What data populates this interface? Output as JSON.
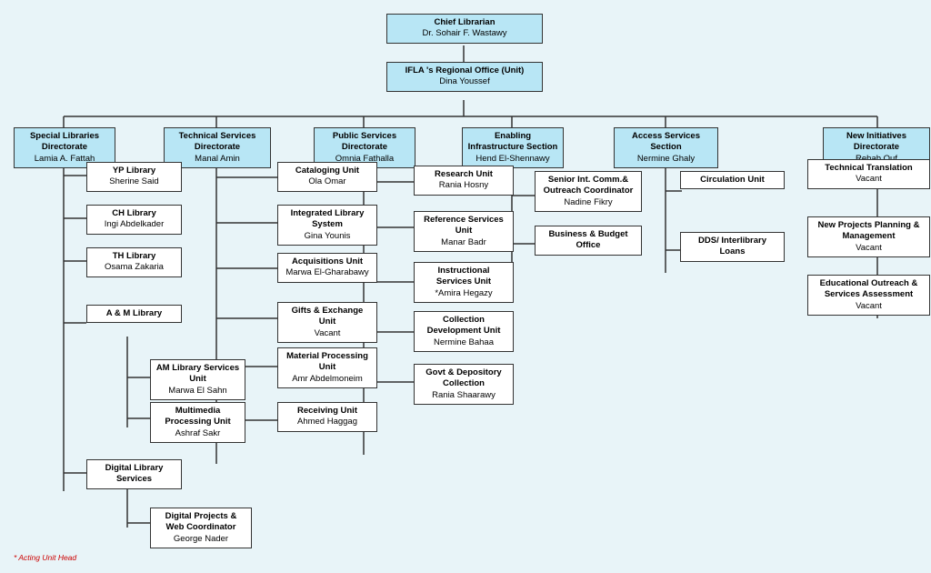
{
  "chart": {
    "title": "Chief Librarian",
    "chief": {
      "title": "Chief Librarian",
      "name": "Dr. Sohair F. Wastawy"
    },
    "ifla": {
      "title": "IFLA 's Regional Office (Unit)",
      "name": "Dina Youssef"
    },
    "directorates": [
      {
        "id": "special",
        "title": "Special Libraries Directorate",
        "name": "Lamia A. Fattah"
      },
      {
        "id": "technical",
        "title": "Technical Services Directorate",
        "name": "Manal Amin"
      },
      {
        "id": "public",
        "title": "Public Services Directorate",
        "name": "Omnia Fathalla"
      },
      {
        "id": "enabling",
        "title": "Enabling Infrastructure Section",
        "name": "Hend El-Shennawy"
      },
      {
        "id": "access",
        "title": "Access Services Section",
        "name": "Nermine Ghaly"
      },
      {
        "id": "new",
        "title": "New Initiatives Directorate",
        "name": "Rehab Ouf"
      }
    ],
    "special_units": [
      {
        "title": "YP Library",
        "name": "Sherine Said"
      },
      {
        "title": "CH Library",
        "name": "Ingi Abdelkader"
      },
      {
        "title": "TH Library",
        "name": "Osama Zakaria"
      },
      {
        "title": "A & M Library",
        "name": ""
      },
      {
        "title": "Digital Library Services",
        "name": ""
      }
    ],
    "am_sub": [
      {
        "title": "AM Library Services Unit",
        "name": "Marwa El Sahn"
      },
      {
        "title": "Multimedia Processing Unit",
        "name": "Ashraf Sakr"
      }
    ],
    "digital_sub": [
      {
        "title": "Digital Projects & Web Coordinator",
        "name": "George Nader"
      }
    ],
    "technical_units": [
      {
        "title": "Cataloging Unit",
        "name": "Ola Omar"
      },
      {
        "title": "Integrated Library System",
        "name": "Gina Younis"
      },
      {
        "title": "Acquisitions Unit",
        "name": "Marwa El-Gharabawy"
      },
      {
        "title": "Gifts & Exchange Unit",
        "name": "Vacant"
      },
      {
        "title": "Material Processing Unit",
        "name": "Amr Abdelmoneim"
      },
      {
        "title": "Receiving Unit",
        "name": "Ahmed Haggag"
      }
    ],
    "public_units": [
      {
        "title": "Research Unit",
        "name": "Rania Hosny"
      },
      {
        "title": "Reference Services Unit",
        "name": "Manar Badr"
      },
      {
        "title": "Instructional Services Unit",
        "name": "*Amira Hegazy"
      },
      {
        "title": "Collection Development Unit",
        "name": "Nermine Bahaa"
      },
      {
        "title": "Govt & Depository Collection",
        "name": "Rania Shaarawy"
      }
    ],
    "enabling_units": [
      {
        "title": "Senior Int. Comm.& Outreach Coordinator",
        "name": "Nadine Fikry"
      },
      {
        "title": "Business & Budget Office",
        "name": ""
      }
    ],
    "access_units": [
      {
        "title": "Circulation Unit",
        "name": ""
      },
      {
        "title": "DDS/ Interlibrary Loans",
        "name": ""
      }
    ],
    "new_units": [
      {
        "title": "Technical Translation",
        "name": "Vacant"
      },
      {
        "title": "New Projects Planning & Management",
        "name": "Vacant"
      },
      {
        "title": "Educational Outreach & Services Assessment",
        "name": "Vacant"
      }
    ],
    "footnote": "* Acting Unit Head"
  }
}
